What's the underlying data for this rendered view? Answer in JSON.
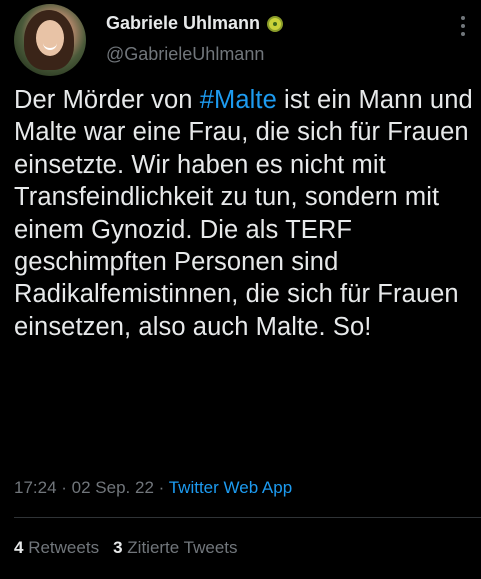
{
  "author": {
    "display_name": "Gabriele Uhlmann",
    "handle": "@GabrieleUhlmann",
    "badge_icon": "kiwi-emoji-icon"
  },
  "tweet": {
    "text_before_hashtag": "Der Mörder von ",
    "hashtag": "#Malte",
    "text_after_hashtag": " ist ein Mann und Malte war eine Frau, die sich für Frauen einsetzte. Wir haben es nicht mit Transfeindlichkeit zu tun, sondern mit einem Gynozid. Die als TERF geschimpften Personen sind Radikalfemistinnen, die sich für Frauen einsetzen, also auch Malte. So!"
  },
  "meta": {
    "time": "17:24",
    "separator_1": " · ",
    "date": "02 Sep. 22",
    "separator_2": " · ",
    "source": "Twitter Web App"
  },
  "stats": {
    "retweets_count": "4",
    "retweets_label": "Retweets",
    "quotes_count": "3",
    "quotes_label": "Zitierte Tweets"
  },
  "colors": {
    "background": "#000000",
    "text": "#e7e9ea",
    "muted": "#71767b",
    "link": "#1d9bf0"
  }
}
